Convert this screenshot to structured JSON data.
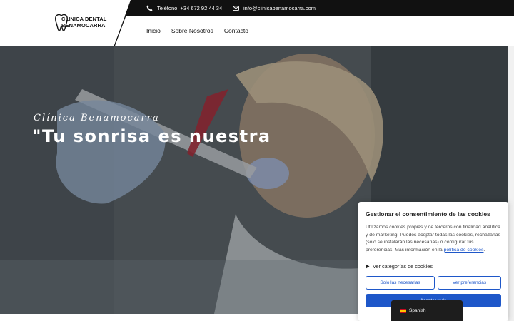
{
  "header": {
    "logo_line1": "CLINICA DENTAL",
    "logo_line2": "BENAMOCARRA",
    "phone": "Teléfono: +34 672 92 44 34",
    "email": "info@clinicabenamocarra.com",
    "nav": [
      {
        "label": "Inicio",
        "active": true
      },
      {
        "label": "Sobre Nosotros",
        "active": false
      },
      {
        "label": "Contacto",
        "active": false
      }
    ]
  },
  "hero": {
    "kicker": "Clínica Benamocarra",
    "title": "\"Tu sonrisa es nuestra"
  },
  "cookie": {
    "title": "Gestionar el consentimiento de las cookies",
    "text": "Utilizamos cookies propias y de terceros con finalidad analítica y de marketing. Puedes aceptar todas las cookies, rechazarlas (solo se instalarán las necesarias) o configurar tus preferencias. Más información en la",
    "link": "política de cookies",
    "text_end": ".",
    "categories": "Ver categorías de cookies",
    "btn_necessary": "Solo las necesarias",
    "btn_prefs": "Ver preferencias",
    "btn_accept": "Aceptar todo"
  },
  "language": {
    "label": "Spanish"
  },
  "colors": {
    "accent": "#1e57c9",
    "topbar": "#111111"
  }
}
